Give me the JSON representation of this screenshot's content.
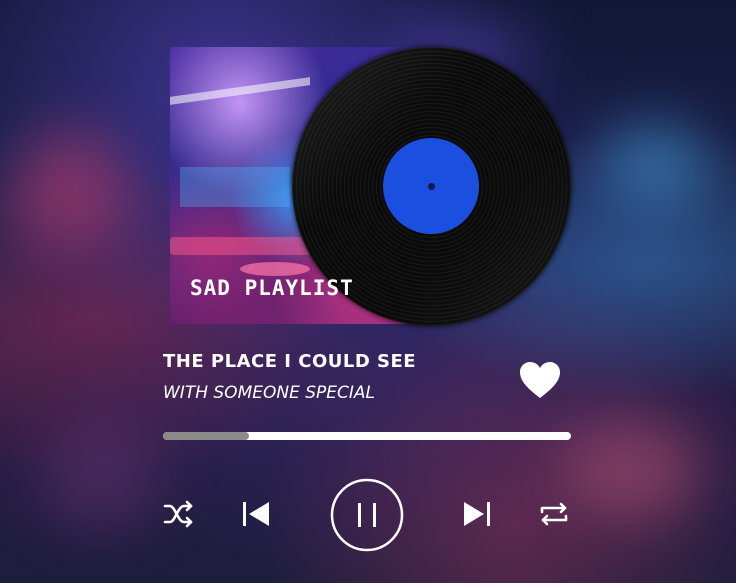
{
  "player": {
    "playlist_label": "SAD PLAYLIST",
    "song_title": "THE PLACE I COULD SEE",
    "song_artist": "WITH SOMEONE SPECIAL",
    "progress_fraction": 0.21,
    "liked": true,
    "is_playing": true
  },
  "icons": {
    "like": "heart-icon",
    "shuffle": "shuffle-icon",
    "previous": "skip-previous-icon",
    "play_pause": "pause-icon",
    "next": "skip-next-icon",
    "repeat": "repeat-icon"
  },
  "colors": {
    "vinyl_label": "#1a4fe0",
    "progress_track": "#ffffff",
    "progress_fill": "#8a8a8a",
    "text": "#ffffff"
  }
}
